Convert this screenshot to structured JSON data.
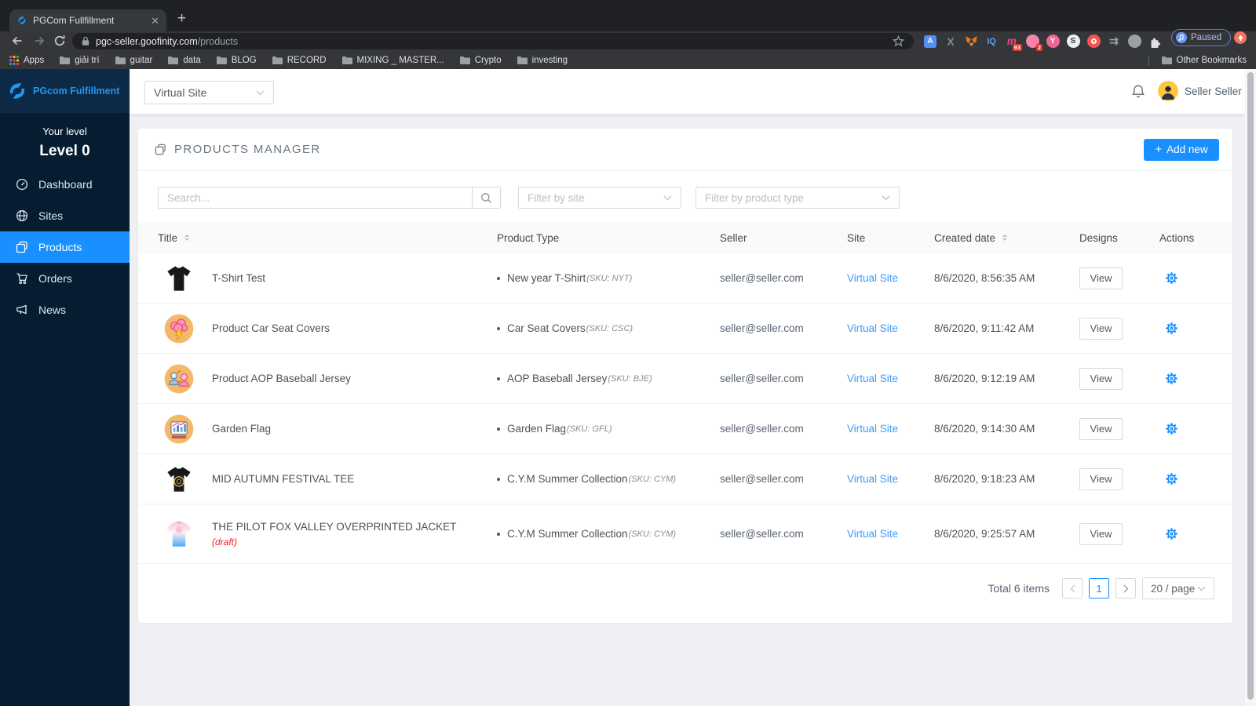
{
  "browser": {
    "tab_title": "PGCom Fullfillment",
    "url_domain": "pgc-seller.goofinity.com",
    "url_path": "/products",
    "paused_label": "Paused",
    "bookmarks": [
      "Apps",
      "giải trí",
      "guitar",
      "data",
      "BLOG",
      "RECORD",
      "MIXING _ MASTER...",
      "Crypto",
      "investing"
    ],
    "other_bookmarks": "Other Bookmarks",
    "extensions": [
      {
        "name": "translate-extension",
        "kind": "sq",
        "bg": "#548ef5",
        "glyph": "A",
        "fg": "#ffffff"
      },
      {
        "name": "x-extension",
        "kind": "txt",
        "glyph": "X",
        "fg": "#85898d"
      },
      {
        "name": "metamask-extension",
        "kind": "fox"
      },
      {
        "name": "iq-extension",
        "kind": "txt",
        "glyph": "IQ",
        "fg": "#58a6f0"
      },
      {
        "name": "m-extension",
        "kind": "txt",
        "glyph": "m",
        "fg": "#e64980",
        "badge": "93"
      },
      {
        "name": "pink-extension",
        "kind": "dot",
        "bg": "#f783ac",
        "badge": "2"
      },
      {
        "name": "y-extension",
        "kind": "dot",
        "bg": "#f06595",
        "glyph": "Y",
        "fg": "#ffffff"
      },
      {
        "name": "s-extension",
        "kind": "dot",
        "bg": "#eceef0",
        "glyph": "S",
        "fg": "#343a40"
      },
      {
        "name": "o-extension",
        "kind": "ring",
        "bg": "#fa5252"
      },
      {
        "name": "arrows-extension",
        "kind": "txt",
        "glyph": "⇉",
        "fg": "#9aa0a6"
      },
      {
        "name": "globe-extension",
        "kind": "dot",
        "bg": "#9aa0a6",
        "glyph": "",
        "fg": "#cfd2d6"
      },
      {
        "name": "puzzle-extension",
        "kind": "puzzle"
      }
    ]
  },
  "sidebar": {
    "brand": "PGcom Fulfillment",
    "level_caption": "Your level",
    "level_value": "Level 0",
    "items": [
      {
        "label": "Dashboard",
        "icon": "dashboard",
        "active": false
      },
      {
        "label": "Sites",
        "icon": "sites",
        "active": false
      },
      {
        "label": "Products",
        "icon": "products",
        "active": true
      },
      {
        "label": "Orders",
        "icon": "orders",
        "active": false
      },
      {
        "label": "News",
        "icon": "news",
        "active": false
      }
    ]
  },
  "topbar": {
    "site_select": "Virtual Site",
    "user_name": "Seller Seller"
  },
  "page": {
    "title": "PRODUCTS MANAGER",
    "add_label": "Add new",
    "search_placeholder": "Search...",
    "filter_site": "Filter by site",
    "filter_type": "Filter by product type",
    "columns": [
      {
        "label": "Title",
        "sort": true
      },
      {
        "label": "Product Type",
        "sort": false
      },
      {
        "label": "Seller",
        "sort": false
      },
      {
        "label": "Site",
        "sort": false
      },
      {
        "label": "Created date",
        "sort": true
      },
      {
        "label": "Designs",
        "sort": false
      },
      {
        "label": "Actions",
        "sort": false
      }
    ],
    "rows": [
      {
        "thumb": "tee-black",
        "title": "T-Shirt Test",
        "draft": "",
        "type": "New year T-Shirt",
        "sku": "(SKU: NYT)",
        "seller": "seller@seller.com",
        "site": "Virtual Site",
        "created": "8/6/2020, 8:56:35 AM",
        "design_label": "View"
      },
      {
        "thumb": "brain",
        "title": "Product Car Seat Covers",
        "draft": "",
        "type": "Car Seat Covers",
        "sku": "(SKU: CSC)",
        "seller": "seller@seller.com",
        "site": "Virtual Site",
        "created": "8/6/2020, 9:11:42 AM",
        "design_label": "View"
      },
      {
        "thumb": "people",
        "title": "Product AOP Baseball Jersey",
        "draft": "",
        "type": "AOP Baseball Jersey",
        "sku": "(SKU: BJE)",
        "seller": "seller@seller.com",
        "site": "Virtual Site",
        "created": "8/6/2020, 9:12:19 AM",
        "design_label": "View"
      },
      {
        "thumb": "chart",
        "title": "Garden Flag",
        "draft": "",
        "type": "Garden Flag",
        "sku": "(SKU: GFL)",
        "seller": "seller@seller.com",
        "site": "Virtual Site",
        "created": "8/6/2020, 9:14:30 AM",
        "design_label": "View"
      },
      {
        "thumb": "tee-gold",
        "title": "MID AUTUMN FESTIVAL TEE",
        "draft": "",
        "type": "C.Y.M Summer Collection",
        "sku": "(SKU: CYM)",
        "seller": "seller@seller.com",
        "site": "Virtual Site",
        "created": "8/6/2020, 9:18:23 AM",
        "design_label": "View"
      },
      {
        "thumb": "jacket",
        "title": "THE PILOT FOX VALLEY OVERPRINTED JACKET",
        "draft": "(draft)",
        "type": "C.Y.M Summer Collection",
        "sku": "(SKU: CYM)",
        "seller": "seller@seller.com",
        "site": "Virtual Site",
        "created": "8/6/2020, 9:25:57 AM",
        "design_label": "View"
      }
    ],
    "pagination": {
      "total": "Total 6 items",
      "page": "1",
      "per_page": "20 / page"
    }
  },
  "colors": {
    "accent": "#1890ff",
    "sidebar_bg": "#061c30",
    "link": "#3d9cf5",
    "draft_red": "#f5222d",
    "avatar_yellow": "#ffc53d"
  }
}
